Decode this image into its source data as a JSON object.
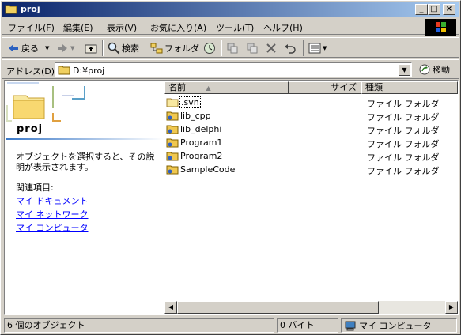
{
  "window": {
    "title": "proj"
  },
  "menu": [
    "ファイル(F)",
    "編集(E)",
    "表示(V)",
    "お気に入り(A)",
    "ツール(T)",
    "ヘルプ(H)"
  ],
  "toolbar": {
    "back": "戻る",
    "search": "検索",
    "folders": "フォルダ"
  },
  "address": {
    "label": "アドレス(D)",
    "value": "D:¥proj",
    "go": "移動"
  },
  "leftpane": {
    "folder_name": "proj",
    "description": "オブジェクトを選択すると、その説明が表示されます。",
    "related_heading": "関連項目:",
    "links": [
      "マイ ドキュメント",
      "マイ ネットワーク",
      "マイ コンピュータ"
    ]
  },
  "columns": {
    "name": "名前",
    "size": "サイズ",
    "type": "種類"
  },
  "files": [
    {
      "name": ".svn",
      "type": "ファイル フォルダ"
    },
    {
      "name": "lib_cpp",
      "type": "ファイル フォルダ"
    },
    {
      "name": "lib_delphi",
      "type": "ファイル フォルダ"
    },
    {
      "name": "Program1",
      "type": "ファイル フォルダ"
    },
    {
      "name": "Program2",
      "type": "ファイル フォルダ"
    },
    {
      "name": "SampleCode",
      "type": "ファイル フォルダ"
    }
  ],
  "status": {
    "objects": "6 個のオブジェクト",
    "size": "0 バイト",
    "location": "マイ コンピュータ"
  },
  "colors": {
    "title_active": "#0a246a",
    "link": "#0000ff",
    "face": "#d4d0c8"
  }
}
